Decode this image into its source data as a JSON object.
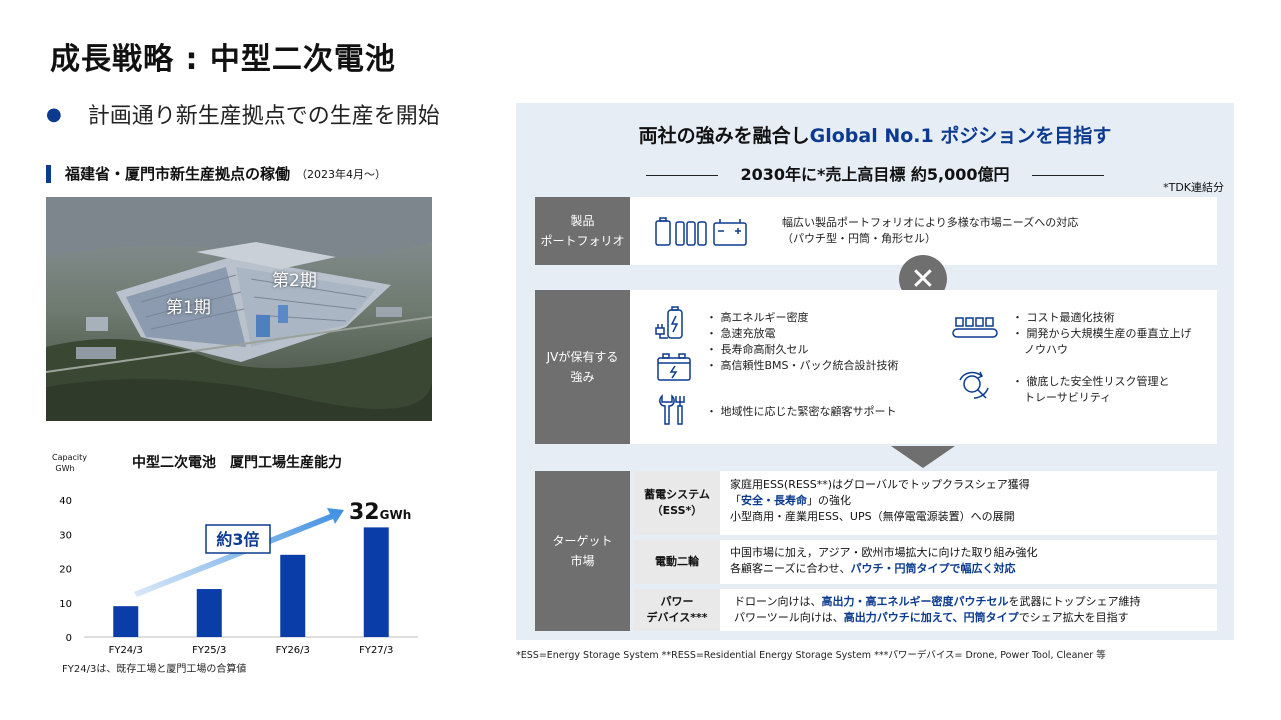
{
  "title": "成長戦略 : 中型二次電池",
  "bullet": "計画通り新生産拠点での生産を開始",
  "section": {
    "heading": "福建省・厦門市新生産拠点の稼働",
    "date": "（2023年4月～）"
  },
  "photo": {
    "phase1": "第1期",
    "phase2": "第2期"
  },
  "chart_data": {
    "type": "bar",
    "title": "中型二次電池　厦門工場生産能力",
    "ylabel": "Capacity GWh",
    "categories": [
      "FY24/3",
      "FY25/3",
      "FY26/3",
      "FY27/3"
    ],
    "values": [
      9,
      14,
      24,
      32
    ],
    "ylim": [
      0,
      40
    ],
    "yticks": [
      "0",
      "10",
      "20",
      "30",
      "40"
    ],
    "annotation_growth": "約3倍",
    "annotation_value": "32",
    "annotation_unit": "GWh",
    "color": "#0b3da8",
    "note": "FY24/3は、既存工場と厦門工場の合算値"
  },
  "panel": {
    "heading_prefix": "両社の強みを融合し",
    "heading_highlight": "Global  No.1  ポジションを目指す",
    "target_line": "2030年に*売上高目標 約5,000億円",
    "tdk_note": "*TDK連結分",
    "portfolio": {
      "label_line1": "製品",
      "label_line2": "ポートフォリオ",
      "text_line1": "幅広い製品ポートフォリオにより多様な市場ニーズへの対応",
      "text_line2": "（パウチ型・円筒・角形セル）"
    },
    "cross_symbol": "✕",
    "strengths": {
      "label_line1": "JVが保有する",
      "label_line2": "強み",
      "left_items": [
        "高エネルギー密度",
        "急速充放電",
        "長寿命高耐久セル",
        "高信頼性BMS・パック統合設計技術"
      ],
      "left_bottom": "地域性に応じた緊密な顧客サポート",
      "right_items": [
        "コスト最適化技術",
        "開発から大規模生産の垂直立上げ",
        "ノウハウ"
      ],
      "right_bottom_line1": "徹底した安全性リスク管理と",
      "right_bottom_line2": "トレーサビリティ"
    },
    "target": {
      "label_line1": "ターゲット",
      "label_line2": "市場",
      "ess_label_line1": "蓄電システム",
      "ess_label_line2": "（ESS*）",
      "ess_line1": "家庭用ESS(RESS**)はグローバルでトップクラスシェア獲得",
      "ess_line2_open": "「",
      "ess_line2_em": "安全・長寿命",
      "ess_line2_close": "」の強化",
      "ess_line3": "小型商用・産業用ESS、UPS（無停電電源装置）への展開",
      "ebike_label": "電動二輪",
      "ebike_line1": "中国市場に加え，アジア・欧州市場拡大に向けた取り組み強化",
      "ebike_line2_pre": "各顧客ニーズに合わせ、",
      "ebike_line2_em": "パウチ・円筒タイプで幅広く対応",
      "power_label_line1": "パワー",
      "power_label_line2": "デバイス***",
      "power_line1_pre": "ドローン向けは、",
      "power_line1_em": "高出力・高エネルギー密度パウチセル",
      "power_line1_post": "を武器にトップシェア維持",
      "power_line2_pre": "パワーツール向けは、",
      "power_line2_em": "高出力パウチに加えて、円筒タイプ",
      "power_line2_post": "でシェア拡大を目指す"
    }
  },
  "footnote": "*ESS=Energy  Storage System   **RESS=Residential  Energy Storage System   ***パワーデバイス= Drone, Power Tool, Cleaner 等"
}
